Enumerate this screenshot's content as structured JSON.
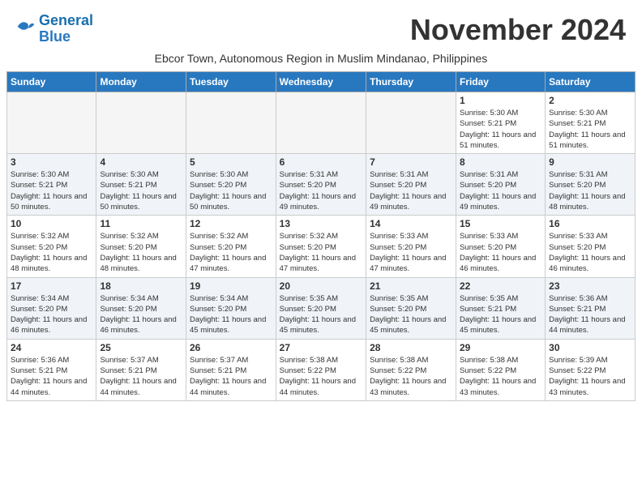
{
  "header": {
    "logo_line1": "General",
    "logo_line2": "Blue",
    "month": "November 2024",
    "subtitle": "Ebcor Town, Autonomous Region in Muslim Mindanao, Philippines"
  },
  "weekdays": [
    "Sunday",
    "Monday",
    "Tuesday",
    "Wednesday",
    "Thursday",
    "Friday",
    "Saturday"
  ],
  "weeks": [
    [
      {
        "day": "",
        "info": ""
      },
      {
        "day": "",
        "info": ""
      },
      {
        "day": "",
        "info": ""
      },
      {
        "day": "",
        "info": ""
      },
      {
        "day": "",
        "info": ""
      },
      {
        "day": "1",
        "info": "Sunrise: 5:30 AM\nSunset: 5:21 PM\nDaylight: 11 hours and 51 minutes."
      },
      {
        "day": "2",
        "info": "Sunrise: 5:30 AM\nSunset: 5:21 PM\nDaylight: 11 hours and 51 minutes."
      }
    ],
    [
      {
        "day": "3",
        "info": "Sunrise: 5:30 AM\nSunset: 5:21 PM\nDaylight: 11 hours and 50 minutes."
      },
      {
        "day": "4",
        "info": "Sunrise: 5:30 AM\nSunset: 5:21 PM\nDaylight: 11 hours and 50 minutes."
      },
      {
        "day": "5",
        "info": "Sunrise: 5:30 AM\nSunset: 5:20 PM\nDaylight: 11 hours and 50 minutes."
      },
      {
        "day": "6",
        "info": "Sunrise: 5:31 AM\nSunset: 5:20 PM\nDaylight: 11 hours and 49 minutes."
      },
      {
        "day": "7",
        "info": "Sunrise: 5:31 AM\nSunset: 5:20 PM\nDaylight: 11 hours and 49 minutes."
      },
      {
        "day": "8",
        "info": "Sunrise: 5:31 AM\nSunset: 5:20 PM\nDaylight: 11 hours and 49 minutes."
      },
      {
        "day": "9",
        "info": "Sunrise: 5:31 AM\nSunset: 5:20 PM\nDaylight: 11 hours and 48 minutes."
      }
    ],
    [
      {
        "day": "10",
        "info": "Sunrise: 5:32 AM\nSunset: 5:20 PM\nDaylight: 11 hours and 48 minutes."
      },
      {
        "day": "11",
        "info": "Sunrise: 5:32 AM\nSunset: 5:20 PM\nDaylight: 11 hours and 48 minutes."
      },
      {
        "day": "12",
        "info": "Sunrise: 5:32 AM\nSunset: 5:20 PM\nDaylight: 11 hours and 47 minutes."
      },
      {
        "day": "13",
        "info": "Sunrise: 5:32 AM\nSunset: 5:20 PM\nDaylight: 11 hours and 47 minutes."
      },
      {
        "day": "14",
        "info": "Sunrise: 5:33 AM\nSunset: 5:20 PM\nDaylight: 11 hours and 47 minutes."
      },
      {
        "day": "15",
        "info": "Sunrise: 5:33 AM\nSunset: 5:20 PM\nDaylight: 11 hours and 46 minutes."
      },
      {
        "day": "16",
        "info": "Sunrise: 5:33 AM\nSunset: 5:20 PM\nDaylight: 11 hours and 46 minutes."
      }
    ],
    [
      {
        "day": "17",
        "info": "Sunrise: 5:34 AM\nSunset: 5:20 PM\nDaylight: 11 hours and 46 minutes."
      },
      {
        "day": "18",
        "info": "Sunrise: 5:34 AM\nSunset: 5:20 PM\nDaylight: 11 hours and 46 minutes."
      },
      {
        "day": "19",
        "info": "Sunrise: 5:34 AM\nSunset: 5:20 PM\nDaylight: 11 hours and 45 minutes."
      },
      {
        "day": "20",
        "info": "Sunrise: 5:35 AM\nSunset: 5:20 PM\nDaylight: 11 hours and 45 minutes."
      },
      {
        "day": "21",
        "info": "Sunrise: 5:35 AM\nSunset: 5:20 PM\nDaylight: 11 hours and 45 minutes."
      },
      {
        "day": "22",
        "info": "Sunrise: 5:35 AM\nSunset: 5:21 PM\nDaylight: 11 hours and 45 minutes."
      },
      {
        "day": "23",
        "info": "Sunrise: 5:36 AM\nSunset: 5:21 PM\nDaylight: 11 hours and 44 minutes."
      }
    ],
    [
      {
        "day": "24",
        "info": "Sunrise: 5:36 AM\nSunset: 5:21 PM\nDaylight: 11 hours and 44 minutes."
      },
      {
        "day": "25",
        "info": "Sunrise: 5:37 AM\nSunset: 5:21 PM\nDaylight: 11 hours and 44 minutes."
      },
      {
        "day": "26",
        "info": "Sunrise: 5:37 AM\nSunset: 5:21 PM\nDaylight: 11 hours and 44 minutes."
      },
      {
        "day": "27",
        "info": "Sunrise: 5:38 AM\nSunset: 5:22 PM\nDaylight: 11 hours and 44 minutes."
      },
      {
        "day": "28",
        "info": "Sunrise: 5:38 AM\nSunset: 5:22 PM\nDaylight: 11 hours and 43 minutes."
      },
      {
        "day": "29",
        "info": "Sunrise: 5:38 AM\nSunset: 5:22 PM\nDaylight: 11 hours and 43 minutes."
      },
      {
        "day": "30",
        "info": "Sunrise: 5:39 AM\nSunset: 5:22 PM\nDaylight: 11 hours and 43 minutes."
      }
    ]
  ]
}
